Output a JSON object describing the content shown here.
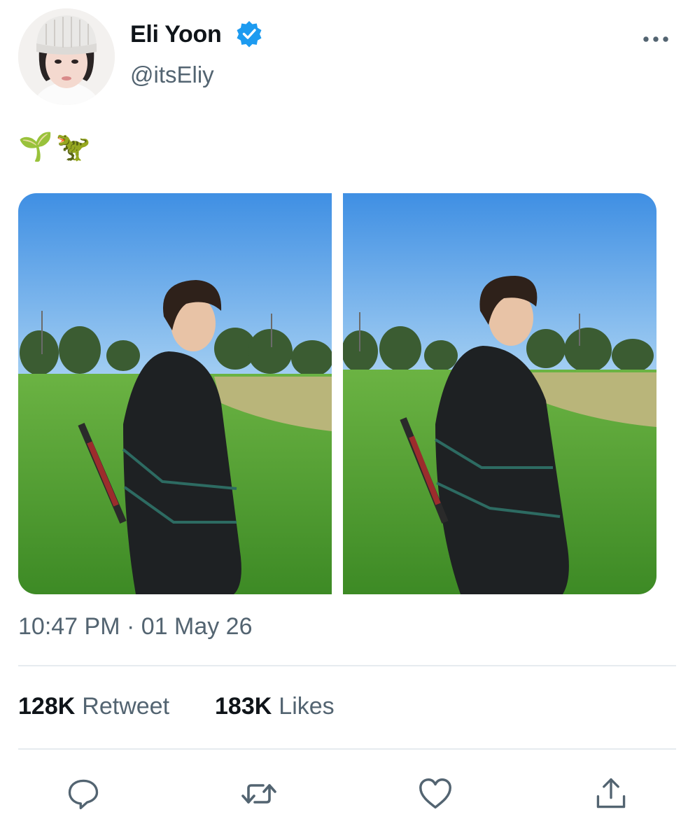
{
  "author": {
    "name": "Eli Yoon",
    "handle": "@itsEliy",
    "verified": true
  },
  "tweet": {
    "text": "🌱🦖",
    "timestamp": "10:47 PM · 01 May 26"
  },
  "stats": {
    "retweets_count": "128K",
    "retweets_label": "Retweet",
    "likes_count": "183K",
    "likes_label": "Likes"
  },
  "icons": {
    "more": "more-horizontal-icon",
    "verified": "verified-badge-icon",
    "reply": "reply-icon",
    "retweet": "retweet-icon",
    "like": "heart-icon",
    "share": "share-icon"
  },
  "colors": {
    "verified_blue": "#1d9bf0",
    "secondary_text": "#536471",
    "primary_text": "#0f1419",
    "divider": "#e6ebef"
  }
}
